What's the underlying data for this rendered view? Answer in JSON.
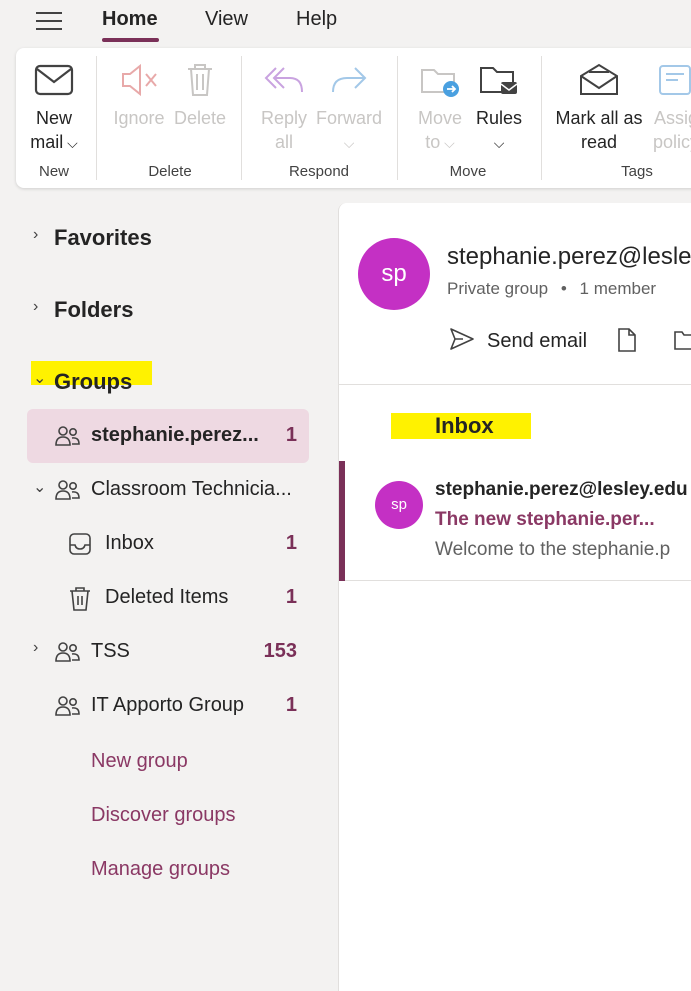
{
  "tabs": [
    {
      "label": "Home",
      "active": true
    },
    {
      "label": "View"
    },
    {
      "label": "Help"
    }
  ],
  "ribbon": {
    "new_group": {
      "label": "New",
      "new_mail_line1": "New",
      "new_mail_line2": "mail"
    },
    "delete_group": {
      "label": "Delete",
      "ignore": "Ignore",
      "delete": "Delete"
    },
    "respond_group": {
      "label": "Respond",
      "reply_all_line1": "Reply",
      "reply_all_line2": "all",
      "forward": "Forward"
    },
    "move_group": {
      "label": "Move",
      "move_to_line1": "Move",
      "move_to_line2": "to",
      "rules": "Rules"
    },
    "tags_group": {
      "label": "Tags",
      "mark_read_line1": "Mark all as",
      "mark_read_line2": "read",
      "assign_line1": "Assig",
      "assign_line2": "policy"
    }
  },
  "nav": {
    "favorites": "Favorites",
    "folders": "Folders",
    "groups": "Groups",
    "items": [
      {
        "label": "stephanie.perez...",
        "count": "1"
      },
      {
        "label": "Classroom Technicia...",
        "count": ""
      },
      {
        "label": "Inbox",
        "count": "1"
      },
      {
        "label": "Deleted Items",
        "count": "1"
      },
      {
        "label": "TSS",
        "count": "153"
      },
      {
        "label": "IT Apporto Group",
        "count": "1"
      }
    ],
    "links": {
      "new_group": "New group",
      "discover_groups": "Discover groups",
      "manage_groups": "Manage groups"
    }
  },
  "group_header": {
    "avatar_initials": "sp",
    "name": "stephanie.perez@lesle",
    "privacy": "Private group",
    "members": "1 member",
    "send_email": "Send email"
  },
  "inbox_title": "Inbox",
  "message": {
    "avatar_initials": "sp",
    "from": "stephanie.perez@lesley.edu",
    "subject": "The new stephanie.per...",
    "preview": "Welcome to the stephanie.p"
  },
  "colors": {
    "accent": "#7a3058",
    "link": "#8a3864",
    "avatar": "#c430c4",
    "highlight": "#fff200",
    "selected_row": "#eed9e2"
  }
}
